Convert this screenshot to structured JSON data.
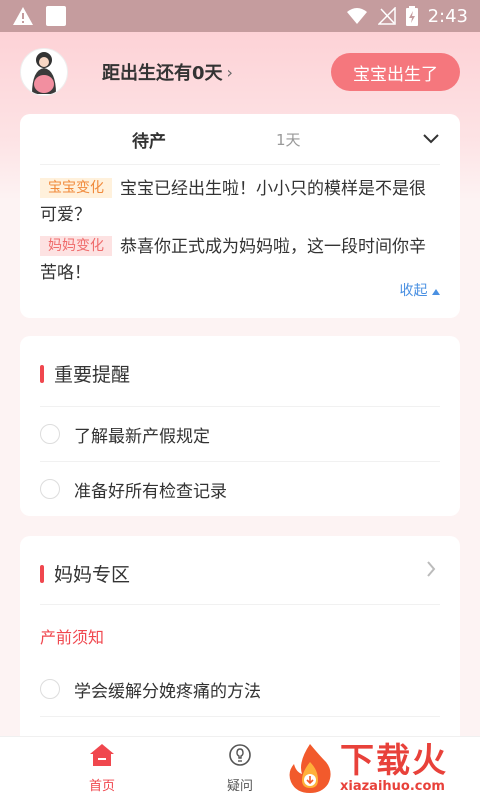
{
  "status_bar": {
    "time": "2:43",
    "icons": [
      "warning-icon",
      "app-square-icon",
      "wifi-icon",
      "no-signal-icon",
      "battery-charging-icon"
    ]
  },
  "header": {
    "countdown": "距出生还有0天",
    "countdown_chevron": "›",
    "born_button": "宝宝出生了"
  },
  "stage_card": {
    "active_tab": "待产",
    "day_label": "1天",
    "baby_tag": "宝宝变化",
    "baby_text": "宝宝已经出生啦！小小只的模样是不是很可爱？",
    "mom_tag": "妈妈变化",
    "mom_text": "恭喜你正式成为妈妈啦，这一段时间你辛苦咯！",
    "collapse_label": "收起"
  },
  "reminders": {
    "title": "重要提醒",
    "items": [
      "了解最新产假规定",
      "准备好所有检查记录"
    ]
  },
  "mom_zone": {
    "title": "妈妈专区",
    "subtitle": "产前须知",
    "items": [
      "学会缓解分娩疼痛的方法"
    ]
  },
  "bottom_nav": {
    "home": "首页",
    "faq": "疑问"
  },
  "watermark": {
    "cn": "下载火",
    "en": "xiazaihuo.com"
  },
  "colors": {
    "accent": "#f0474e",
    "button": "#f5777d",
    "link": "#4a90e2",
    "baby_tag_bg": "#fff1dc",
    "mom_tag_bg": "#fde2e2"
  }
}
